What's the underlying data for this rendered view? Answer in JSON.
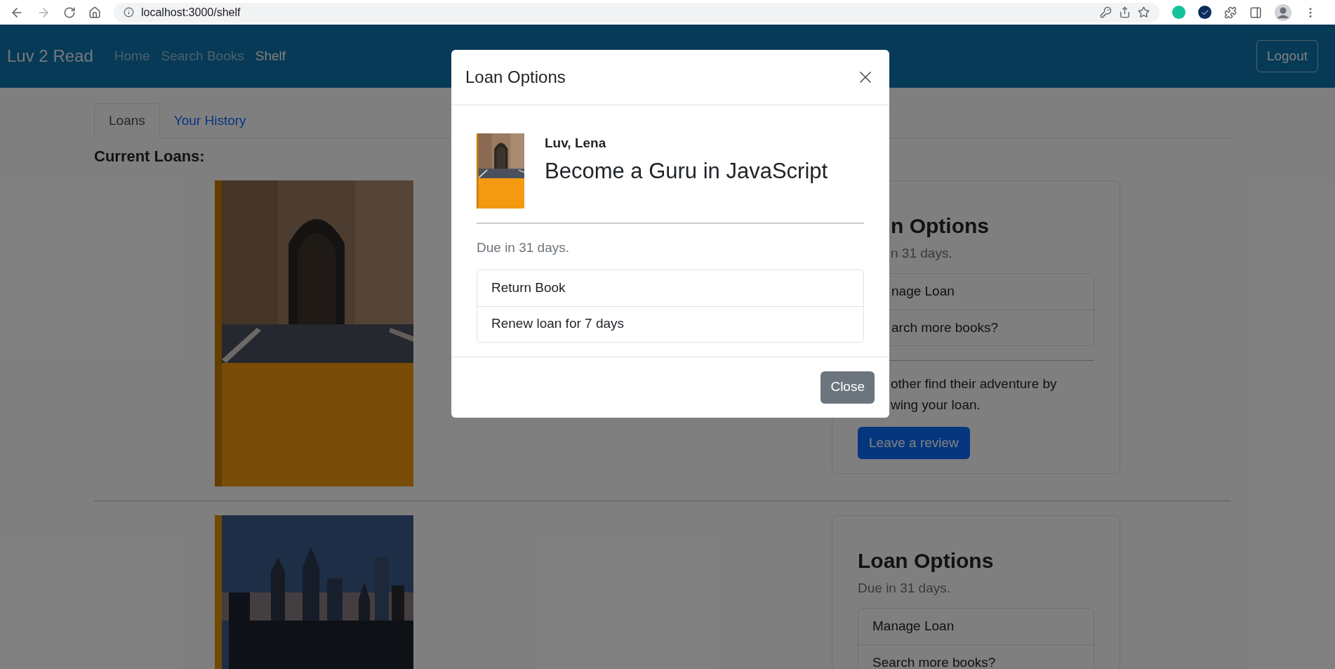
{
  "browser": {
    "url": "localhost:3000/shelf"
  },
  "navbar": {
    "brand": "Luv 2 Read",
    "links": [
      {
        "label": "Home",
        "selected": false
      },
      {
        "label": "Search Books",
        "selected": false
      },
      {
        "label": "Shelf",
        "selected": true
      }
    ],
    "logout": "Logout"
  },
  "tabs": [
    {
      "label": "Loans",
      "selected": true
    },
    {
      "label": "Your History",
      "selected": false
    }
  ],
  "section_title": "Current Loans:",
  "loans": [
    {
      "cover": {
        "kind": "picture"
      },
      "card": {
        "title": "n Options",
        "due": "n 31 days.",
        "actions": [
          "nage Loan",
          "arch more books?"
        ],
        "message_lines": [
          "other find their adventure by",
          "wing your loan."
        ],
        "review_button": "Leave a review"
      }
    },
    {
      "cover": {
        "kind": "picture"
      },
      "card": {
        "title": "Loan Options",
        "due": "Due in 31 days.",
        "actions": [
          "Manage Loan",
          "Search more books?"
        ]
      }
    }
  ],
  "modal": {
    "title": "Loan Options",
    "cover": {
      "kind": "picture"
    },
    "author": "Luv, Lena",
    "book_title": "Become a Guru in JavaScript",
    "due": "Due in 31 days.",
    "actions": [
      "Return Book",
      "Renew loan for 7 days"
    ],
    "close_button": "Close"
  }
}
